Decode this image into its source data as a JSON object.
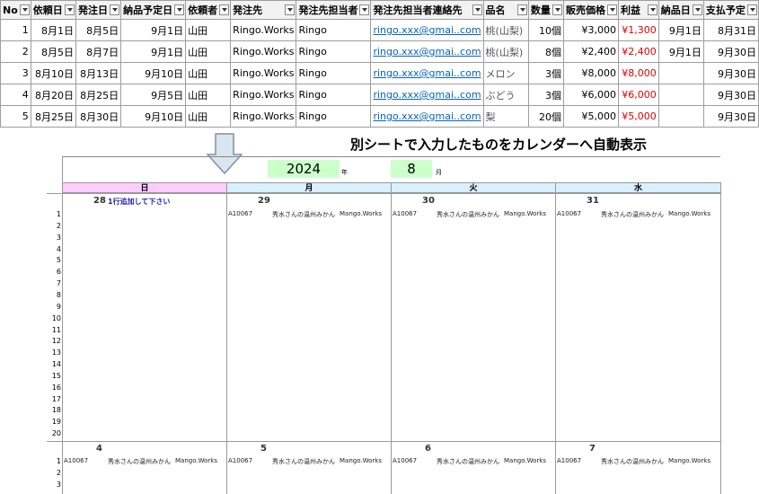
{
  "table": {
    "headers": [
      "No",
      "依頼日",
      "発注日",
      "納品予定日",
      "依頼者",
      "発注先",
      "発注先担当者",
      "発注先担当者連絡先",
      "品名",
      "数量",
      "販売価格",
      "利益",
      "納品日",
      "支払予定"
    ],
    "rows": [
      [
        "1",
        "8月1日",
        "8月5日",
        "9月1日",
        "山田",
        "Ringo.Works",
        "Ringo",
        "ringo.xxx@gmai..com",
        "桃(山梨)",
        "10個",
        "¥3,000",
        "¥1,300",
        "9月1日",
        "8月31日"
      ],
      [
        "2",
        "8月5日",
        "8月7日",
        "9月1日",
        "山田",
        "Ringo.Works",
        "Ringo",
        "ringo.xxx@gmai..com",
        "桃(山梨)",
        "8個",
        "¥2,400",
        "¥2,400",
        "9月1日",
        "9月30日"
      ],
      [
        "3",
        "8月10日",
        "8月13日",
        "9月10日",
        "山田",
        "Ringo.Works",
        "Ringo",
        "ringo.xxx@gmai..com",
        "メロン",
        "3個",
        "¥8,000",
        "¥8,000",
        "",
        "9月30日"
      ],
      [
        "4",
        "8月20日",
        "8月25日",
        "9月5日",
        "山田",
        "Ringo.Works",
        "Ringo",
        "ringo.xxx@gmai..com",
        "ぶどう",
        "3個",
        "¥6,000",
        "¥6,000",
        "",
        "9月30日"
      ],
      [
        "5",
        "8月25日",
        "8月30日",
        "9月10日",
        "山田",
        "Ringo.Works",
        "Ringo",
        "ringo.xxx@gmai..com",
        "梨",
        "20個",
        "¥5,000",
        "¥5,000",
        "",
        "9月30日"
      ]
    ]
  },
  "heading": "別シートで入力したものをカレンダーへ自動表示",
  "calendar": {
    "year": "2024",
    "year_suffix": "年",
    "month": "8",
    "month_suffix": "月",
    "weekdays": [
      "日",
      "月",
      "火",
      "水"
    ],
    "weekday_colors": [
      "#ffccff",
      "#d9f0ff",
      "#d9f0ff",
      "#d9f0ff"
    ],
    "week1": {
      "days": [
        "28",
        "29",
        "30",
        "31"
      ],
      "note": "1行追加して下さい"
    },
    "week2": {
      "days": [
        "4",
        "5",
        "6",
        "7"
      ]
    },
    "entry": {
      "code": "A10067",
      "item": "秀水さんの温州みかん",
      "vendor": "Mango.Works"
    },
    "row_numbers_week1": [
      "1",
      "2",
      "3",
      "4",
      "5",
      "6",
      "7",
      "8",
      "9",
      "10",
      "11",
      "12",
      "13",
      "14",
      "15",
      "16",
      "17",
      "18",
      "19",
      "20"
    ],
    "row_numbers_week2": [
      "1",
      "2",
      "3"
    ]
  },
  "colors": {
    "negative": "#e00000",
    "link": "#0563c1",
    "input_bg": "#ccffcc",
    "note": "#1f1fb3"
  }
}
